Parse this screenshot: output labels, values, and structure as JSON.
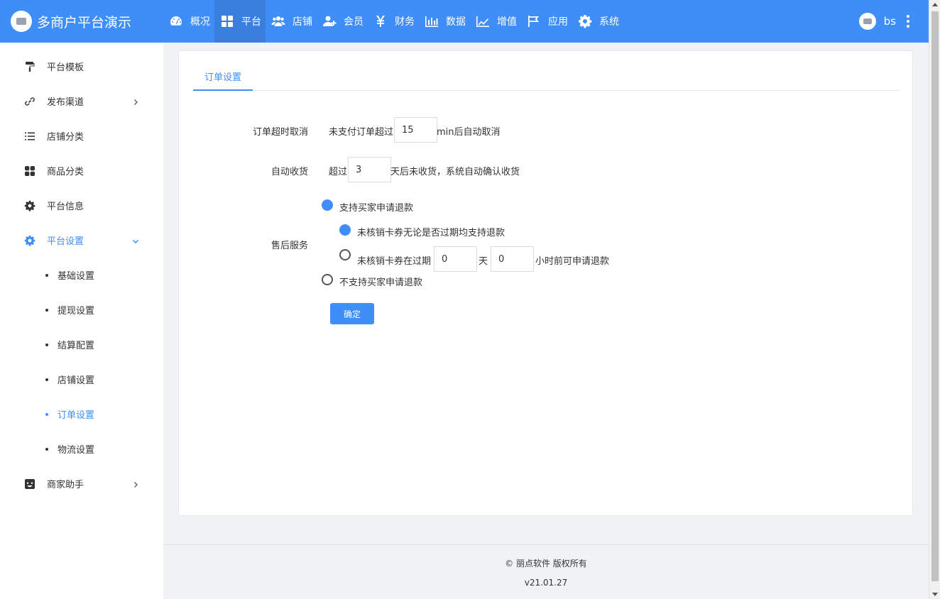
{
  "brand": {
    "title": "多商户平台演示"
  },
  "colors": {
    "primary": "#3f8ef7",
    "nav_active": "#3a7fdd"
  },
  "nav": [
    {
      "label": "概况",
      "icon": "dashboard-icon"
    },
    {
      "label": "平台",
      "icon": "grid-icon",
      "active": true
    },
    {
      "label": "店铺",
      "icon": "users-icon"
    },
    {
      "label": "会员",
      "icon": "user-plus-icon"
    },
    {
      "label": "财务",
      "icon": "yen-icon"
    },
    {
      "label": "数据",
      "icon": "bar-chart-icon"
    },
    {
      "label": "增值",
      "icon": "line-chart-icon"
    },
    {
      "label": "应用",
      "icon": "flag-icon"
    },
    {
      "label": "系统",
      "icon": "gear-icon"
    }
  ],
  "user": {
    "name": "bs"
  },
  "sidebar": {
    "items": [
      {
        "label": "平台模板",
        "icon": "paint-roller-icon"
      },
      {
        "label": "发布渠道",
        "icon": "link-icon",
        "arrow": "right"
      },
      {
        "label": "店铺分类",
        "icon": "list-icon"
      },
      {
        "label": "商品分类",
        "icon": "apps-icon"
      },
      {
        "label": "平台信息",
        "icon": "gear-icon"
      },
      {
        "label": "平台设置",
        "icon": "gear-icon",
        "arrow": "down",
        "open": true
      },
      {
        "label": "商家助手",
        "icon": "smile-icon",
        "arrow": "right"
      }
    ],
    "sub_items": [
      {
        "label": "基础设置"
      },
      {
        "label": "提现设置"
      },
      {
        "label": "结算配置"
      },
      {
        "label": "店铺设置"
      },
      {
        "label": "订单设置",
        "active": true
      },
      {
        "label": "物流设置"
      }
    ]
  },
  "main": {
    "tab": "订单设置",
    "timeout": {
      "label": "订单超时取消",
      "prefix": "未支付订单超过",
      "value": "15",
      "suffix": "min后自动取消"
    },
    "auto_receive": {
      "label": "自动收货",
      "prefix": "超过",
      "value": "3",
      "suffix": "天后未收货，系统自动确认收货"
    },
    "after_sale": {
      "label": "售后服务",
      "opt_support": "支持买家申请退款",
      "sub_opt_any": "未核销卡券无论是否过期均支持退款",
      "sub_opt_before": "未核销卡券在过期",
      "days_value": "0",
      "days_unit": "天",
      "hours_value": "0",
      "hours_suffix": "小时前可申请退款",
      "opt_no_support": "不支持买家申请退款"
    },
    "confirm_label": "确定"
  },
  "footer": {
    "copyright": "© 丽点软件 版权所有",
    "version": "v21.01.27"
  }
}
